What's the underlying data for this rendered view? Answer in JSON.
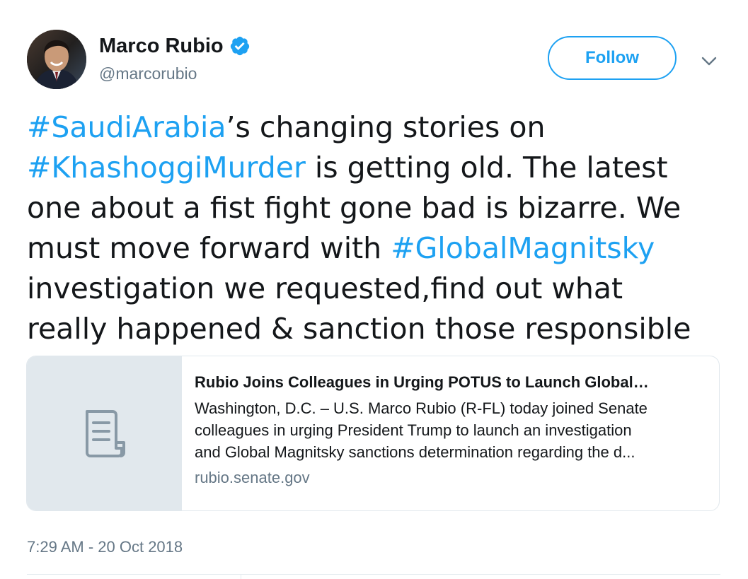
{
  "author": {
    "display_name": "Marco Rubio",
    "handle": "@marcorubio",
    "verified": true,
    "avatar_icon": "user-avatar-photo"
  },
  "follow_button": {
    "label": "Follow",
    "color": "#1da1f2"
  },
  "menu_icon": "chevron-down-icon",
  "tweet": {
    "lines": [
      [
        {
          "t": "#SaudiArabia",
          "tag": true
        },
        {
          "t": "’s changing stories on",
          "tag": false
        }
      ],
      [
        {
          "t": "#KhashoggiMurder",
          "tag": true
        },
        {
          "t": " is getting old. The latest",
          "tag": false
        }
      ],
      [
        {
          "t": "one about a fist fight gone bad is bizarre. We",
          "tag": false
        }
      ],
      [
        {
          "t": "must move forward with ",
          "tag": false
        },
        {
          "t": "#GlobalMagnitsky",
          "tag": true
        }
      ],
      [
        {
          "t": "investigation we requested,find out what",
          "tag": false
        }
      ],
      [
        {
          "t": "really happened & sanction those responsible",
          "tag": false
        }
      ]
    ]
  },
  "card": {
    "icon": "document-icon",
    "title": "Rubio Joins Colleagues in Urging POTUS to Launch Global…",
    "description_lines": [
      "Washington, D.C. – U.S. Marco Rubio (R-FL) today joined Senate",
      "colleagues in urging President Trump to launch an investigation",
      "and Global Magnitsky sanctions determination regarding the d..."
    ],
    "domain": "rubio.senate.gov"
  },
  "timestamp": "7:29 AM - 20 Oct 2018",
  "colors": {
    "accent": "#1da1f2",
    "secondary_text": "#657786",
    "primary_text": "#14171a",
    "card_border": "#e1e8ed"
  }
}
